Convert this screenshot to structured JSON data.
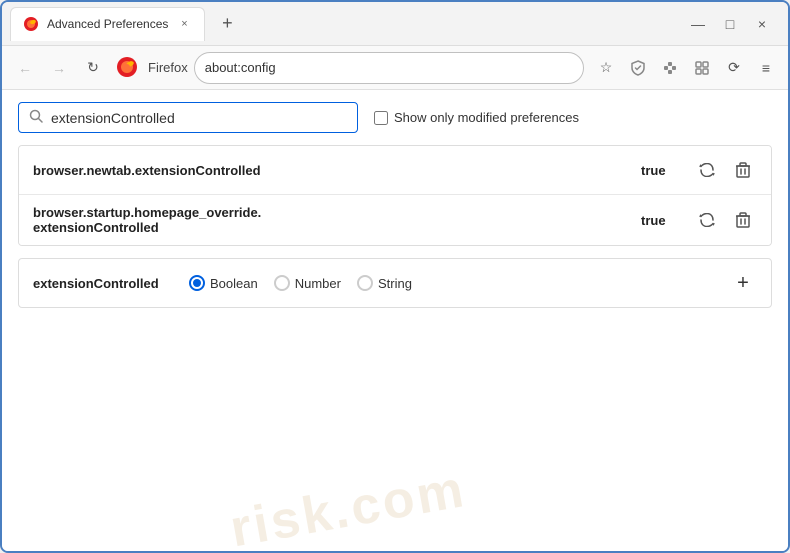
{
  "window": {
    "title": "Advanced Preferences",
    "tab_close": "×",
    "new_tab": "+",
    "win_minimize": "—",
    "win_maximize": "□",
    "win_close": "×"
  },
  "toolbar": {
    "back_label": "←",
    "forward_label": "→",
    "reload_label": "↻",
    "browser_name": "Firefox",
    "address": "about:config",
    "bookmark_icon": "☆",
    "shield_icon": "🛡",
    "extension_icon": "🧩",
    "container_icon": "📧",
    "sync_icon": "⟳",
    "menu_icon": "≡"
  },
  "search": {
    "placeholder": "extensionControlled",
    "value": "extensionControlled",
    "checkbox_label": "Show only modified preferences"
  },
  "preferences": {
    "rows": [
      {
        "name": "browser.newtab.extensionControlled",
        "value": "true"
      },
      {
        "name": "browser.startup.homepage_override.\nextensionControlled",
        "name_line1": "browser.startup.homepage_override.",
        "name_line2": "extensionControlled",
        "value": "true",
        "multiline": true
      }
    ],
    "new_pref": {
      "name": "extensionControlled",
      "type_boolean": "Boolean",
      "type_number": "Number",
      "type_string": "String",
      "selected_type": "Boolean"
    }
  },
  "icons": {
    "reset": "⇄",
    "delete": "🗑",
    "add": "+",
    "search": "🔍"
  },
  "watermark": "risk.com"
}
